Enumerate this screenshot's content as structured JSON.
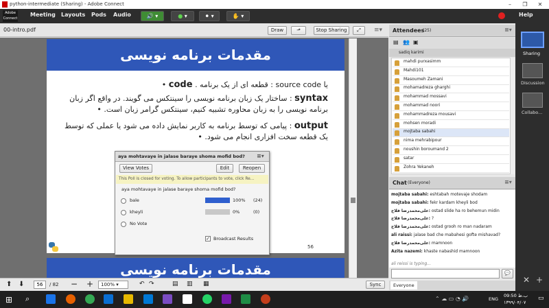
{
  "window": {
    "title": "python-intermediate (Sharing) - Adobe Connect"
  },
  "menu": {
    "logo_line1": "Adobe",
    "logo_line2": "Connect",
    "items": [
      "Meeting",
      "Layouts",
      "Pods",
      "Audio"
    ],
    "help": "Help"
  },
  "share": {
    "filename": "00-intro.pdf",
    "draw_label": "Draw",
    "stop_label": "Stop Sharing"
  },
  "slide": {
    "title": "مقدمات برنامه نویسی",
    "bullets": [
      {
        "term": "code",
        "text": "یا source code : قطعه ای از یک برنامه ."
      },
      {
        "term": "syntax",
        "text": ": ساختار یک زبان برنامه نویسی را سینتکس می گویند. در واقع اگر زبان برنامه نویسی را به زبان محاوره تشبیه کنیم، سینتکس گرامر زبان است."
      },
      {
        "term": "output",
        "text": ": پیامی که توسط برنامه به کاربر نمایش داده می شود یا عملی که توسط یک قطعه سخت افزاری انجام می شود."
      }
    ],
    "page_num": "56",
    "next_title": "مقدمات برنامه نویسی"
  },
  "poll": {
    "header": "aya mohtavaye in jalase baraye shoma mofid bod?",
    "view_votes": "View Votes",
    "edit": "Edit",
    "reopen": "Reopen",
    "notice": "This Poll is closed for voting. To allow participants to vote, click Re...",
    "question": "aya mohtavaye in jalase baraye shoma mofid bod?",
    "options": [
      {
        "label": "bale",
        "pct": "100%",
        "count": "(24)",
        "fill": 1.0
      },
      {
        "label": "kheyli",
        "pct": "0%",
        "count": "(0)",
        "fill": 0.0
      },
      {
        "label": "No Vote",
        "pct": "",
        "count": "",
        "fill": null
      }
    ],
    "broadcast": "Broadcast Results"
  },
  "statusbar": {
    "page": "56",
    "total": "/ 82",
    "zoom": "100%",
    "sync": "Sync"
  },
  "attendees": {
    "title": "Attendees",
    "count": "(25)",
    "host": "sadiq karimi",
    "list": [
      "mahdi purxasimm",
      "Mahdi101",
      "Masoumeh Zamani",
      "mohamadreza gharghi",
      "mohammad mossavi",
      "mohammad noori",
      "mohammadreza mousavi",
      "mohsen moradi",
      "mojtaba sabahi",
      "nima mehrabipour",
      "noushin boroumand 2",
      "satar",
      "Zohra Yekaneh"
    ]
  },
  "chat": {
    "title": "Chat",
    "scope": "(Everyone)",
    "lines": [
      {
        "who": "mojtaba sabahi:",
        "msg": "eshtabah motevaje shodam"
      },
      {
        "who": "mojtaba sabahi:",
        "msg": "fekr kardam kheyli bod"
      },
      {
        "who": "علی‌محمدرضا فلاح:",
        "msg": "ostad slide ha ro behemun midin"
      },
      {
        "who": "علی‌محمدرضا فلاح:",
        "msg": "?"
      },
      {
        "who": "علی‌محمدرضا فلاح:",
        "msg": "ostad grooh ro man nadaram"
      },
      {
        "who": "ali raissi:",
        "msg": "jalase bad che mabahesi gofte mishavad?"
      },
      {
        "who": "علی‌محمدرضا فلاح:",
        "msg": "mamnoon"
      },
      {
        "who": "Azita nazemi:",
        "msg": "khaste nabashid mamnoon"
      }
    ],
    "typing": "ali reissi is typing...",
    "tab": "Everyone"
  },
  "pods": [
    "Sharing",
    "Discussion",
    "Collabo..."
  ],
  "taskbar": {
    "time": "09:50 ب.ظ",
    "date": "۱۳۹۹/۰۴/۰۷",
    "lang": "ENG"
  }
}
